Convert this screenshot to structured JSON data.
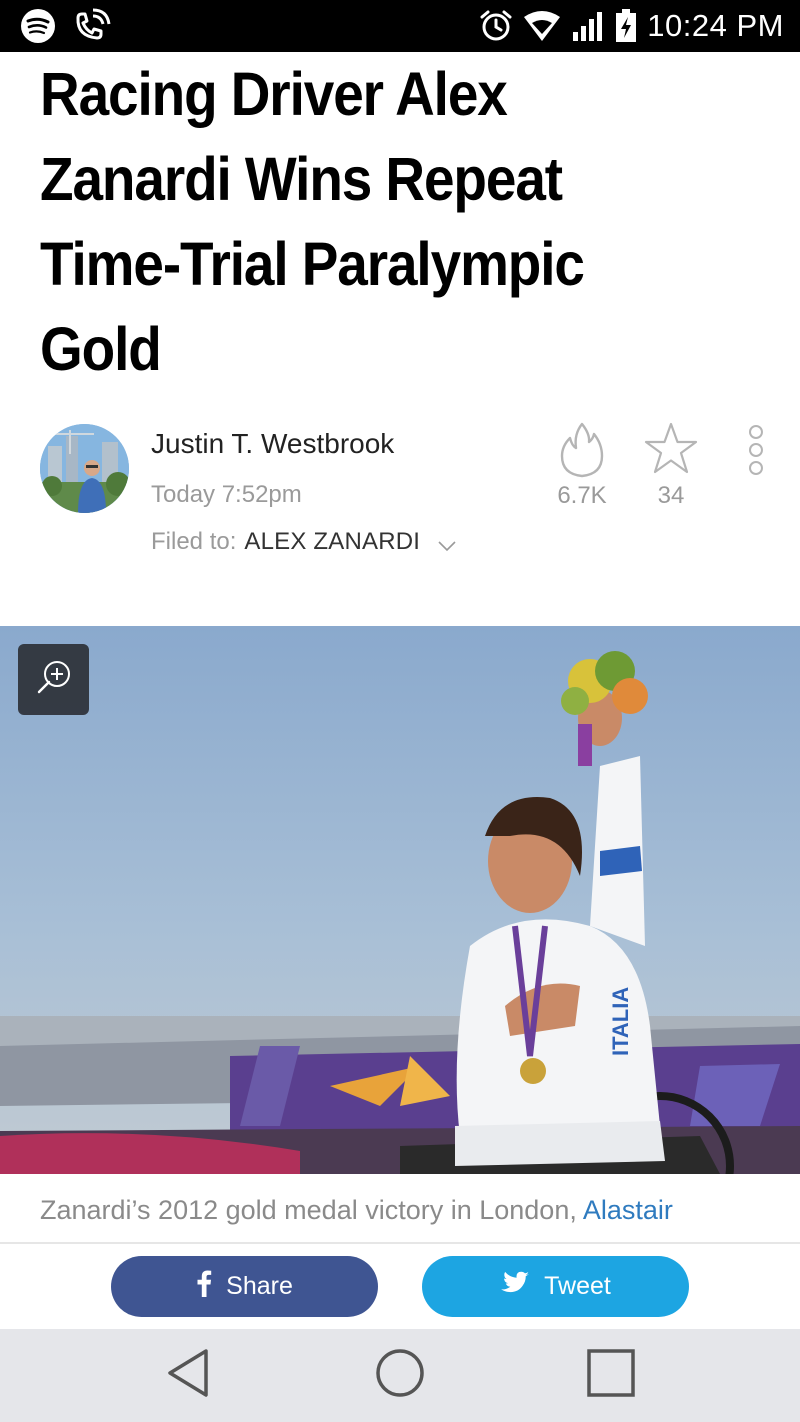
{
  "status_bar": {
    "time": "10:24 PM",
    "left_icons": [
      "spotify-icon",
      "wifi-calling-icon"
    ],
    "right_icons": [
      "alarm-icon",
      "wifi-icon",
      "signal-icon",
      "battery-charging-icon"
    ]
  },
  "article": {
    "title": "Racing Driver Alex Zanardi Wins Repeat Time-Trial Paralympic Gold",
    "author": "Justin T. Westbrook",
    "date": "Today 7:52pm",
    "filed_prefix": "Filed to:",
    "filed_tag": "ALEX ZANARDI",
    "hot_count": "6.7K",
    "star_count": "34",
    "caption_text": "Zanardi’s 2012 gold medal victory in London,",
    "caption_credit": "Alastair",
    "photo_jersey_text": "ITALIA"
  },
  "share": {
    "share_label": "Share",
    "tweet_label": "Tweet"
  },
  "colors": {
    "share_bg": "#3f5592",
    "tweet_bg": "#1da5e2",
    "link": "#2f7bbf",
    "meta_gray": "#9a9a9a"
  },
  "nav": {
    "items": [
      "back-icon",
      "home-icon",
      "recents-icon"
    ]
  }
}
